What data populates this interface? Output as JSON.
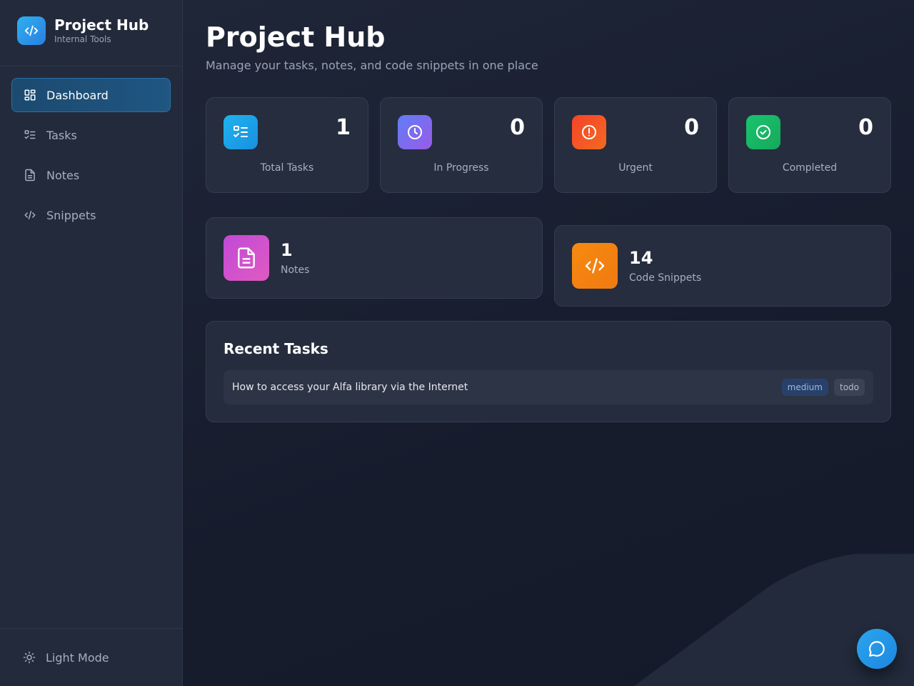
{
  "brand": {
    "title": "Project Hub",
    "subtitle": "Internal Tools",
    "icon": "code-icon"
  },
  "nav": {
    "items": [
      {
        "label": "Dashboard",
        "icon": "dashboard-icon",
        "active": true
      },
      {
        "label": "Tasks",
        "icon": "tasks-icon",
        "active": false
      },
      {
        "label": "Notes",
        "icon": "notes-icon",
        "active": false
      },
      {
        "label": "Snippets",
        "icon": "code-icon",
        "active": false
      }
    ],
    "footer_label": "Light Mode",
    "footer_icon": "sun-icon"
  },
  "header": {
    "title": "Project Hub",
    "subtitle": "Manage your tasks, notes, and code snippets in one place"
  },
  "stats": [
    {
      "value": "1",
      "label": "Total Tasks",
      "icon": "list-check-icon",
      "color": "#1ea7e8"
    },
    {
      "value": "0",
      "label": "In Progress",
      "icon": "clock-icon",
      "color": "#7a6cf0"
    },
    {
      "value": "0",
      "label": "Urgent",
      "icon": "alert-icon",
      "color": "#f0552a"
    },
    {
      "value": "0",
      "label": "Completed",
      "icon": "check-circle-icon",
      "color": "#1fbf6a"
    }
  ],
  "summary": [
    {
      "value": "1",
      "label": "Notes",
      "icon": "file-icon",
      "color": "#c94fd8"
    },
    {
      "value": "14",
      "label": "Code Snippets",
      "icon": "code-icon",
      "color": "#f5880f"
    }
  ],
  "recent": {
    "title": "Recent Tasks",
    "tasks": [
      {
        "title": "How to access your Alfa library via the Internet",
        "priority": "medium",
        "status": "todo"
      }
    ]
  },
  "chat": {
    "icon": "chat-bubble-icon"
  }
}
